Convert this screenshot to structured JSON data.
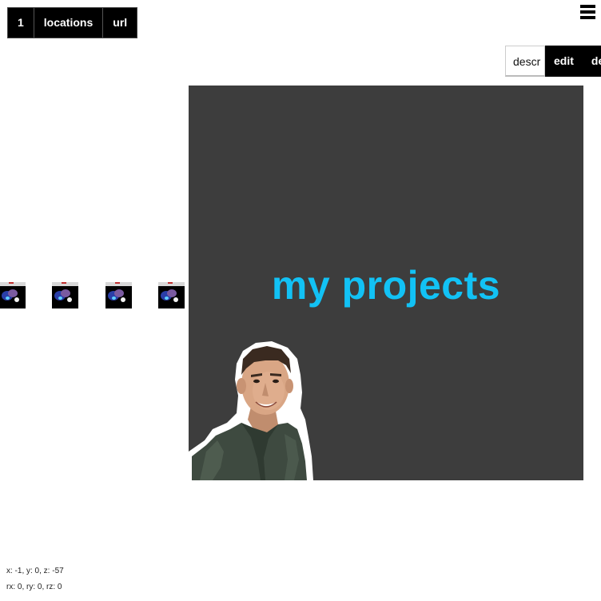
{
  "nav": {
    "items": [
      {
        "label": "1"
      },
      {
        "label": "locations"
      },
      {
        "label": "url"
      }
    ]
  },
  "menu_icon": "hamburger-icon",
  "tabs": [
    {
      "label": "descr"
    },
    {
      "label": "edit"
    },
    {
      "label": "del"
    }
  ],
  "thumbnails": [
    {
      "icon": "project-thumbnail"
    },
    {
      "icon": "project-thumbnail"
    },
    {
      "icon": "project-thumbnail"
    },
    {
      "icon": "project-thumbnail"
    }
  ],
  "stage": {
    "title": "my projects",
    "title_color": "#12c2f5",
    "background": "#3d3d3d"
  },
  "status": {
    "position": "x: -1, y: 0, z: -57",
    "rotation": "rx: 0, ry: 0, rz: 0"
  }
}
